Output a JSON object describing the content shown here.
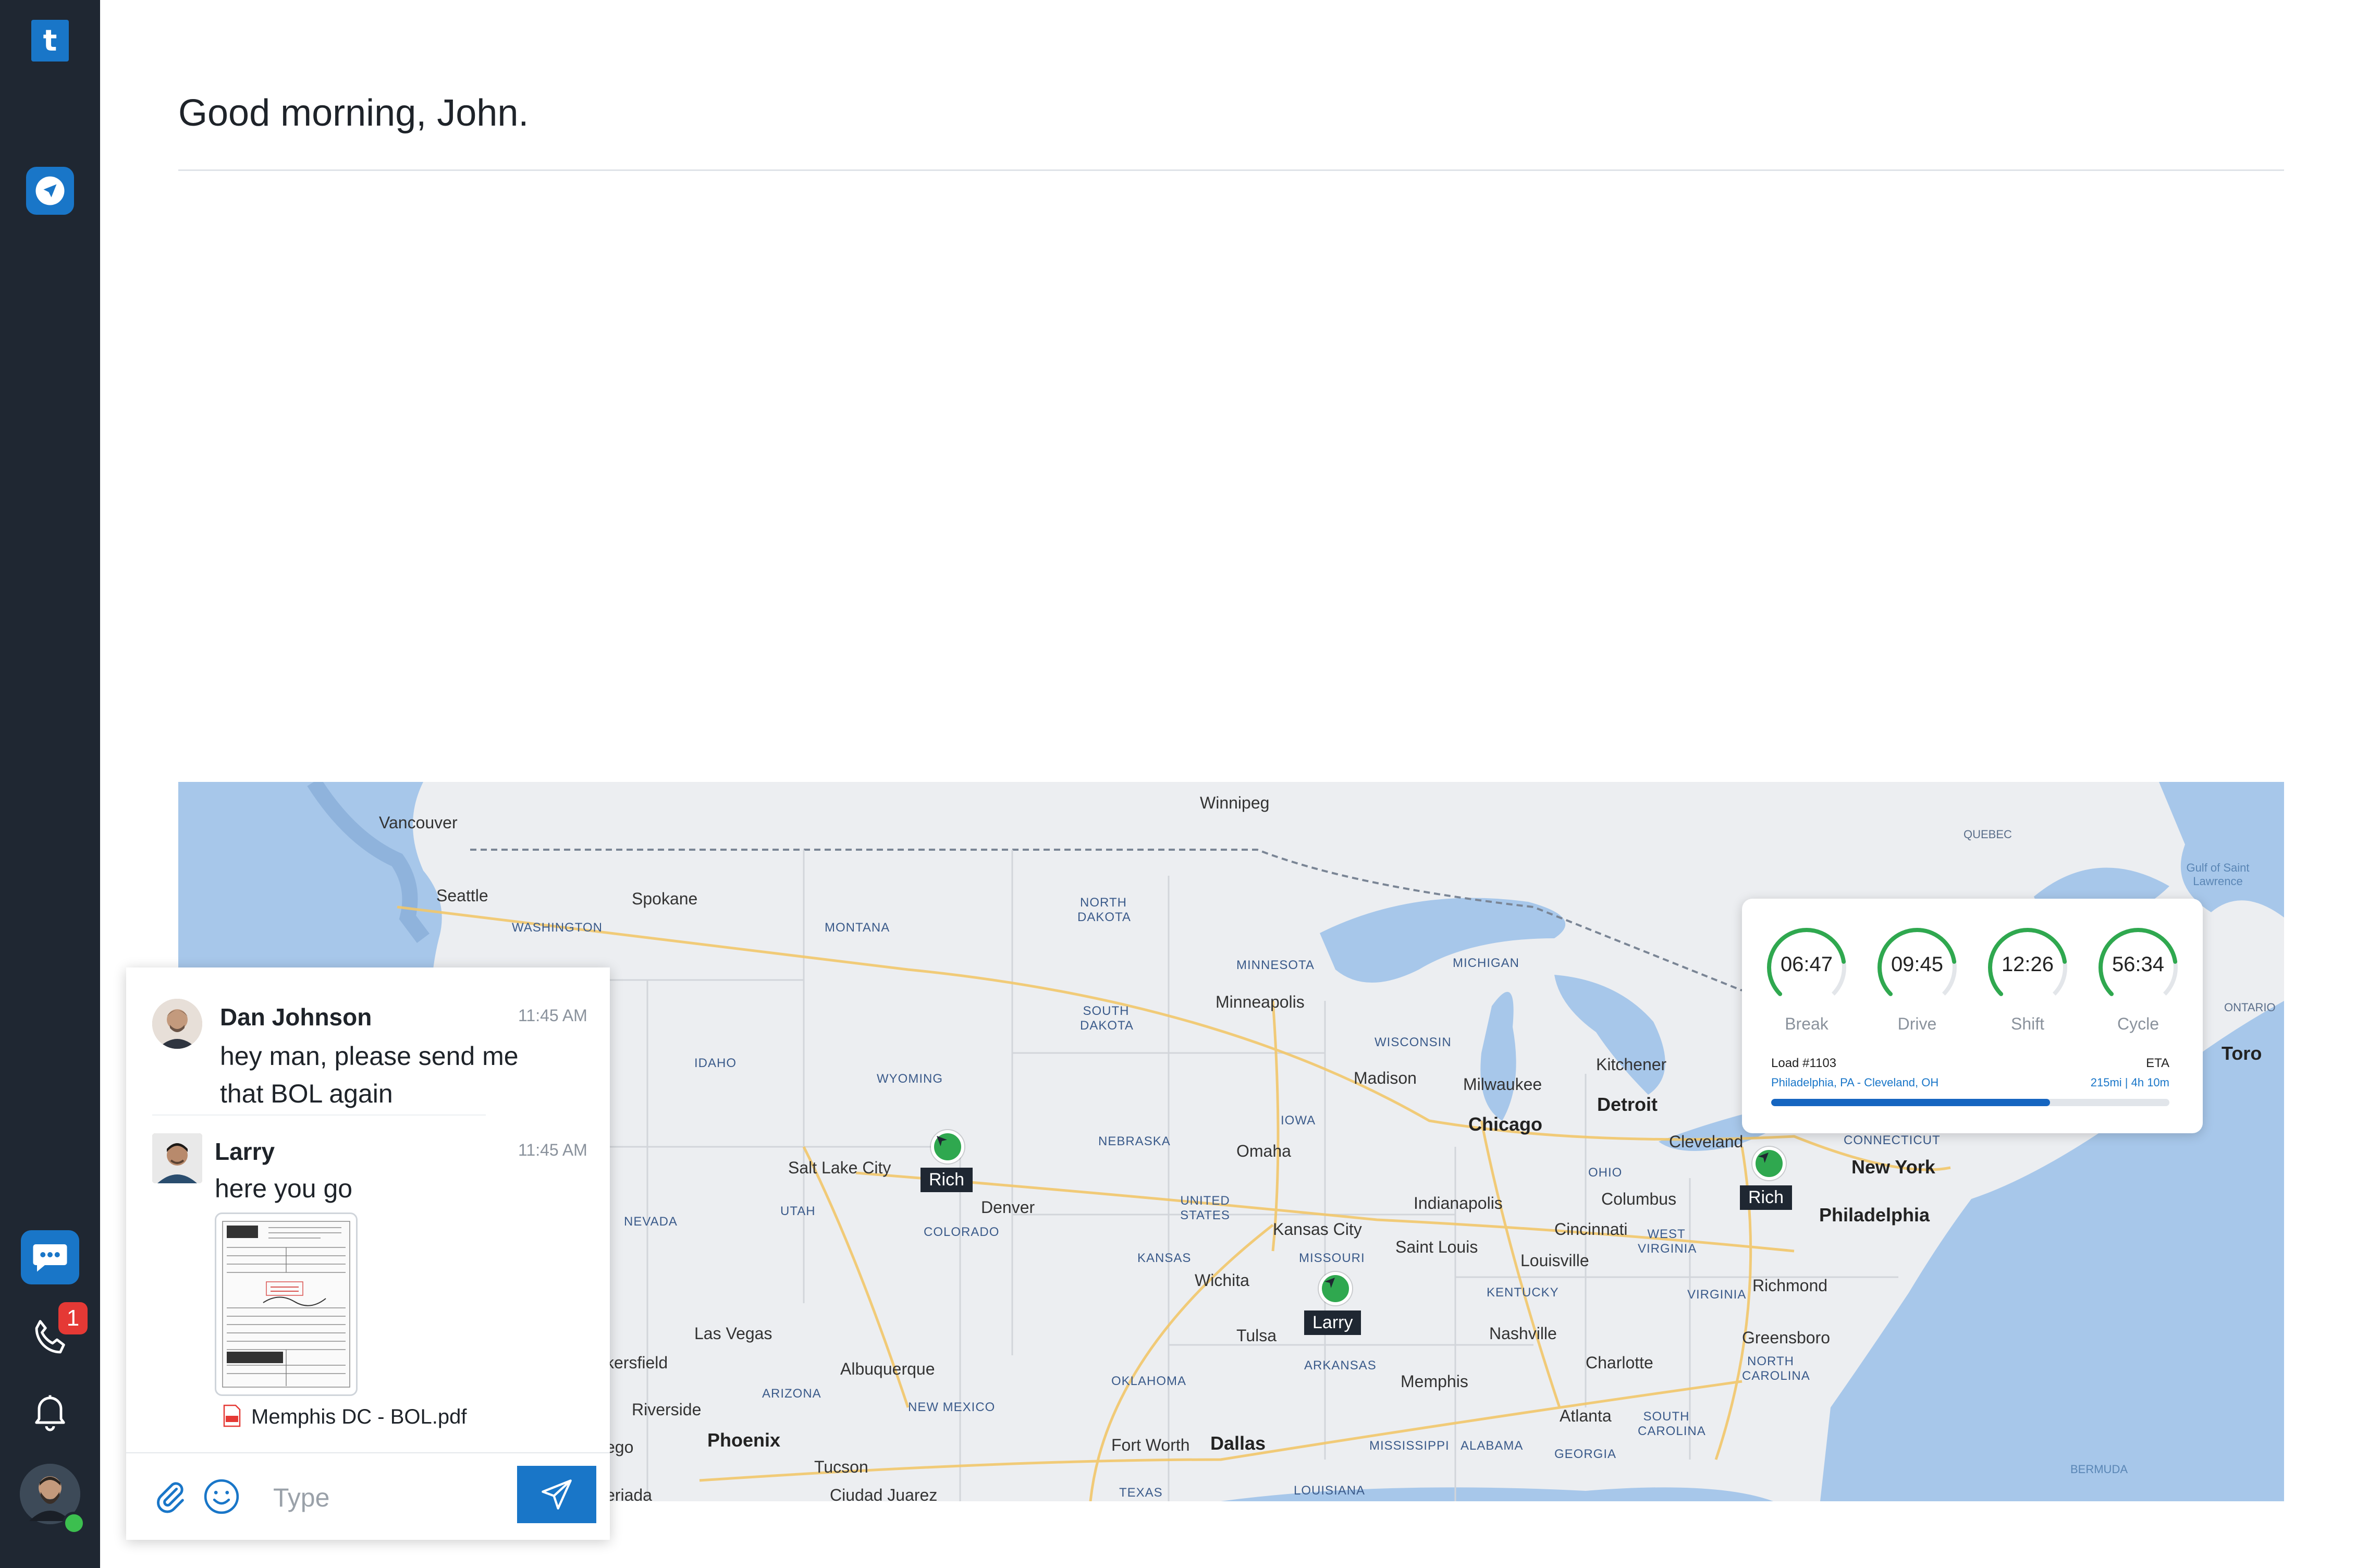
{
  "app": {
    "logo_letter": "t",
    "accent": "#1976c8",
    "sidebar_bg": "#1f2732",
    "phone_badge": "1"
  },
  "header": {
    "greeting": "Good morning, John."
  },
  "map": {
    "cities": [
      {
        "name": "Vancouver"
      },
      {
        "name": "Seattle"
      },
      {
        "name": "Spokane"
      },
      {
        "name": "Winnipeg"
      },
      {
        "name": "Minneapolis"
      },
      {
        "name": "Madison"
      },
      {
        "name": "Milwaukee"
      },
      {
        "name": "Chicago"
      },
      {
        "name": "Detroit"
      },
      {
        "name": "Kitchener"
      },
      {
        "name": "Cleveland"
      },
      {
        "name": "New York"
      },
      {
        "name": "Philadelphia"
      },
      {
        "name": "Omaha"
      },
      {
        "name": "Salt Lake City"
      },
      {
        "name": "Denver"
      },
      {
        "name": "Kansas City"
      },
      {
        "name": "Saint Louis"
      },
      {
        "name": "Indianapolis"
      },
      {
        "name": "Columbus"
      },
      {
        "name": "Cincinnati"
      },
      {
        "name": "Louisville"
      },
      {
        "name": "Richmond"
      },
      {
        "name": "Wichita"
      },
      {
        "name": "Nashville"
      },
      {
        "name": "Greensboro"
      },
      {
        "name": "Charlotte"
      },
      {
        "name": "Tulsa"
      },
      {
        "name": "Memphis"
      },
      {
        "name": "Atlanta"
      },
      {
        "name": "Las Vegas"
      },
      {
        "name": "Albuquerque"
      },
      {
        "name": "Phoenix"
      },
      {
        "name": "Tucson"
      },
      {
        "name": "Dallas"
      },
      {
        "name": "Fort Worth"
      },
      {
        "name": "Riverside"
      },
      {
        "name": "Toro"
      },
      {
        "name": "Ciudad Juarez"
      },
      {
        "name": "ego"
      },
      {
        "name": "kersfield"
      },
      {
        "name": "eriada"
      }
    ],
    "states": [
      "WASHINGTON",
      "MONTANA",
      "NORTH DAKOTA",
      "MINNESOTA",
      "MICHIGAN",
      "ONTARIO",
      "QUEBEC",
      "SOUTH DAKOTA",
      "WISCONSIN",
      "IDAHO",
      "WYOMING",
      "IOWA",
      "NEBRASKA",
      "OHIO",
      "UNITED STATES",
      "NEVADA",
      "UTAH",
      "COLORADO",
      "KANSAS",
      "MISSOURI",
      "WEST VIRGINIA",
      "VIRGINIA",
      "KENTUCKY",
      "CONNECTICUT",
      "NORTH CAROLINA",
      "OKLAHOMA",
      "ARKANSAS",
      "ARIZONA",
      "NEW MEXICO",
      "MISSISSIPPI",
      "ALABAMA",
      "GEORGIA",
      "SOUTH CAROLINA",
      "TEXAS",
      "LOUISIANA"
    ],
    "water": [
      "Gulf of Saint Lawrence",
      "BERMUDA"
    ],
    "drivers": [
      {
        "name": "Rich"
      },
      {
        "name": "Larry"
      },
      {
        "name": "Rich"
      }
    ]
  },
  "hos": {
    "gauges": [
      {
        "value": "06:47",
        "label": "Break",
        "fill": 0.8
      },
      {
        "value": "09:45",
        "label": "Drive",
        "fill": 0.8
      },
      {
        "value": "12:26",
        "label": "Shift",
        "fill": 0.8
      },
      {
        "value": "56:34",
        "label": "Cycle",
        "fill": 0.8
      }
    ],
    "load_label": "Load #1103",
    "eta_label": "ETA",
    "route": "Philadelphia, PA - Cleveland, OH",
    "distance": "215mi | 4h 10m",
    "progress": 0.7,
    "gauge_color": "#2fa84f"
  },
  "chat": {
    "messages": [
      {
        "name": "Dan Johnson",
        "time": "11:45 AM",
        "text": "hey man, please send me that BOL again"
      },
      {
        "name": "Larry",
        "time": "11:45 AM",
        "text": "here you go"
      }
    ],
    "attachment": {
      "filename": "Memphis DC - BOL.pdf"
    },
    "input_placeholder": "Type"
  }
}
